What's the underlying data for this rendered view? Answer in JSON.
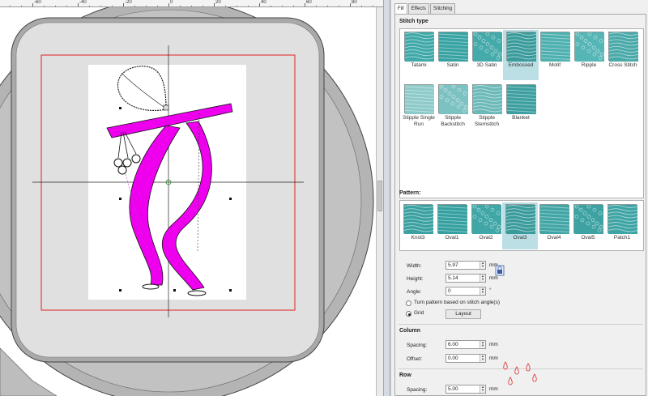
{
  "ruler": {
    "labels": [
      "-80",
      "-60",
      "-40",
      "-20",
      "0",
      "20",
      "40",
      "60",
      "80"
    ]
  },
  "tabs": [
    {
      "label": "Fill"
    },
    {
      "label": "Effects"
    },
    {
      "label": "Stitching"
    }
  ],
  "stitch_type": {
    "title": "Stitch type",
    "items": [
      {
        "label": "Tatami",
        "selected": false,
        "color": "#3fa8a8"
      },
      {
        "label": "Satin",
        "selected": false,
        "color": "#38a3a3"
      },
      {
        "label": "3D Satin",
        "selected": false,
        "color": "#45aaaa"
      },
      {
        "label": "Embossed",
        "selected": true,
        "color": "#3a9b9b"
      },
      {
        "label": "Motif",
        "selected": false,
        "color": "#4fb0b0"
      },
      {
        "label": "Ripple",
        "selected": false,
        "color": "#56b5b5"
      },
      {
        "label": "Cross Stitch",
        "selected": false,
        "color": "#4aa9a9"
      },
      {
        "label": "Stipple Single Run",
        "selected": false,
        "color": "#8ecaca"
      },
      {
        "label": "Stipple Backstitch",
        "selected": false,
        "color": "#7cc2c2"
      },
      {
        "label": "Stipple Stemstitch",
        "selected": false,
        "color": "#6cb9b9"
      },
      {
        "label": "Blanket",
        "selected": false,
        "color": "#3d9f9f"
      }
    ]
  },
  "pattern": {
    "title": "Pattern:",
    "items": [
      {
        "label": "Knot3",
        "selected": false,
        "color": "#3aa0a0"
      },
      {
        "label": "Oval1",
        "selected": false,
        "color": "#35a0a0"
      },
      {
        "label": "Oval2",
        "selected": false,
        "color": "#40a6a6"
      },
      {
        "label": "Oval3",
        "selected": true,
        "color": "#3a9b9b"
      },
      {
        "label": "Oval4",
        "selected": false,
        "color": "#42a5a5"
      },
      {
        "label": "Oval5",
        "selected": false,
        "color": "#3ea2a2"
      },
      {
        "label": "Patch1",
        "selected": false,
        "color": "#3fa4a4"
      }
    ]
  },
  "fields": {
    "width": {
      "label": "Width:",
      "value": "5.97",
      "unit": "mm"
    },
    "height": {
      "label": "Height:",
      "value": "5.14",
      "unit": "mm"
    },
    "angle": {
      "label": "Angle:",
      "value": "0",
      "unit": "°"
    }
  },
  "options": {
    "turn_pattern": {
      "label": "Turn pattern based on stitch angle(s)",
      "checked": false
    },
    "grid": {
      "label": "Grid",
      "checked": true
    },
    "layout_button": "Layout"
  },
  "column": {
    "title": "Column",
    "spacing": {
      "label": "Spacing:",
      "value": "6.00",
      "unit": "mm"
    },
    "offset": {
      "label": "Offset:",
      "value": "0.00",
      "unit": "mm"
    }
  },
  "row": {
    "title": "Row",
    "spacing": {
      "label": "Spacing:",
      "value": "5.00",
      "unit": "mm"
    }
  }
}
